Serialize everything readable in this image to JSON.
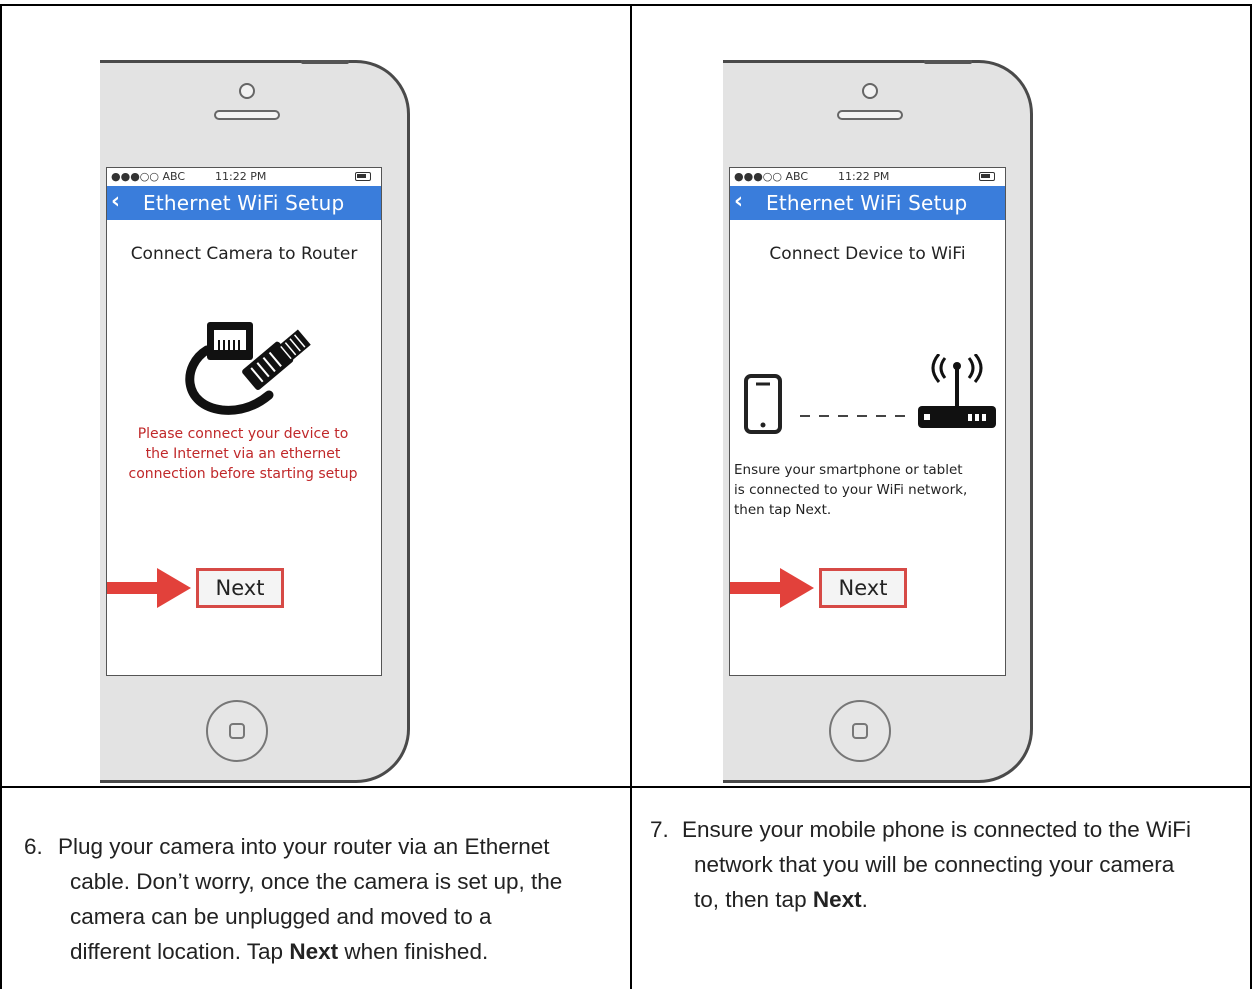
{
  "screens": [
    {
      "carrier": "●●●○○ ABC",
      "time": "11:22 PM",
      "nav_title": "Ethernet WiFi Setup",
      "heading": "Connect Camera to Router",
      "icon": "ethernet-cable-icon",
      "message_lines": [
        "Please connect your device to",
        "the Internet via an ethernet",
        "connection before starting setup"
      ],
      "next_label": "Next"
    },
    {
      "carrier": "●●●○○ ABC",
      "time": "11:22 PM",
      "nav_title": "Ethernet WiFi Setup",
      "heading": "Connect Device to WiFi",
      "icon": "smartphone-router-icon",
      "message_lines": [
        "Ensure your smartphone or tablet",
        "is connected to your WiFi network,",
        "then tap Next."
      ],
      "next_label": "Next"
    }
  ],
  "steps": [
    {
      "number": "6.",
      "line1": "Plug your camera into your router via an Ethernet",
      "line2": "cable. Don’t worry, once the camera is set up, the",
      "line3": "camera can be unplugged and moved to a",
      "line4_pre": "different location. Tap ",
      "line4_bold": "Next",
      "line4_post": " when finished."
    },
    {
      "number": "7.",
      "line1": "Ensure your mobile phone is connected to the WiFi",
      "line2": "network that you will be connecting your camera",
      "line3_pre": "to, then tap ",
      "line3_bold": "Next",
      "line3_post": "."
    }
  ],
  "colors": {
    "navbar": "#3a7ddb",
    "warning": "#c0282a",
    "highlight": "#d64a46",
    "arrow": "#e2413b"
  }
}
